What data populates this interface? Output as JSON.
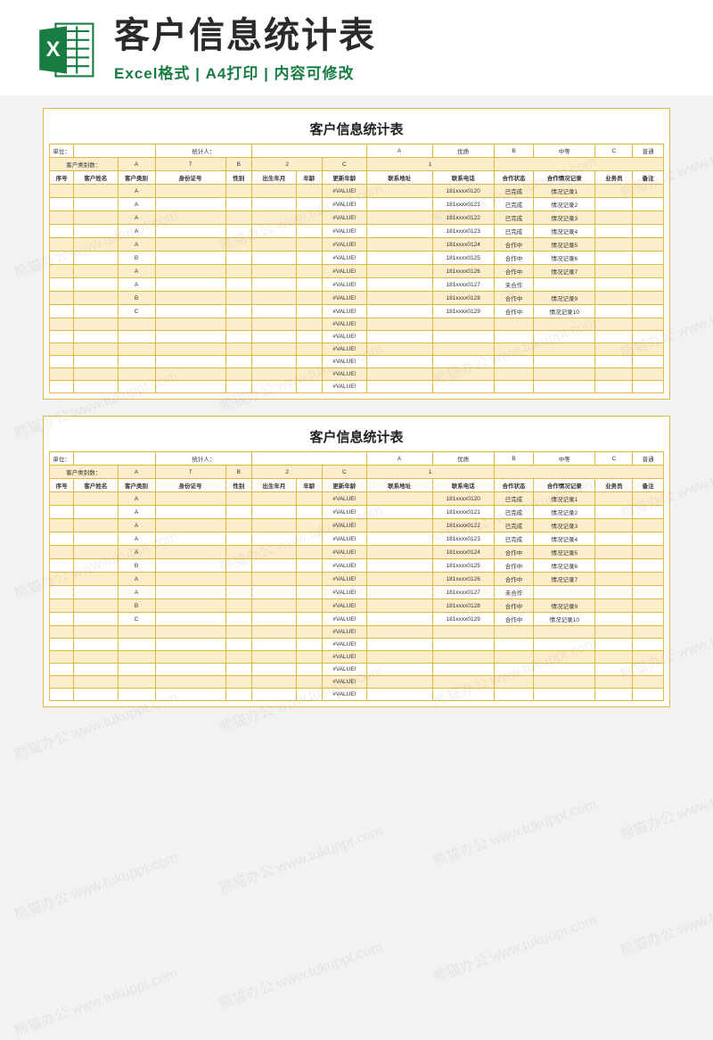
{
  "header": {
    "title": "客户信息统计表",
    "subtitle": "Excel格式 | A4打印 | 内容可修改",
    "icon_letter": "X"
  },
  "sheet": {
    "title": "客户信息统计表",
    "summary1": {
      "unit_label": "单位：",
      "statistician_label": "统计人：",
      "a_label": "A",
      "a_val": "优质",
      "b_label": "B",
      "b_val": "中等",
      "c_label": "C",
      "c_val": "普通"
    },
    "summary2": {
      "label": "客户类别数：",
      "a": "A",
      "a_count": "7",
      "b": "B",
      "b_count": "2",
      "c": "C",
      "c_count": "1"
    },
    "columns": [
      "序号",
      "客户姓名",
      "客户类别",
      "身份证号",
      "性别",
      "出生年月",
      "年龄",
      "更新年龄",
      "联系地址",
      "联系电话",
      "合作状态",
      "合作情况记录",
      "业务员",
      "备注"
    ],
    "rows": [
      {
        "cat": "A",
        "age": "#VALUE!",
        "phone": "181xxxx0120",
        "status": "已完成",
        "rec": "情况记录1"
      },
      {
        "cat": "A",
        "age": "#VALUE!",
        "phone": "181xxxx0121",
        "status": "已完成",
        "rec": "情况记录2"
      },
      {
        "cat": "A",
        "age": "#VALUE!",
        "phone": "181xxxx0122",
        "status": "已完成",
        "rec": "情况记录3"
      },
      {
        "cat": "A",
        "age": "#VALUE!",
        "phone": "181xxxx0123",
        "status": "已完成",
        "rec": "情况记录4"
      },
      {
        "cat": "A",
        "age": "#VALUE!",
        "phone": "181xxxx0124",
        "status": "合作中",
        "rec": "情况记录5"
      },
      {
        "cat": "B",
        "age": "#VALUE!",
        "phone": "181xxxx0125",
        "status": "合作中",
        "rec": "情况记录6"
      },
      {
        "cat": "A",
        "age": "#VALUE!",
        "phone": "181xxxx0126",
        "status": "合作中",
        "rec": "情况记录7"
      },
      {
        "cat": "A",
        "age": "#VALUE!",
        "phone": "181xxxx0127",
        "status": "未合作",
        "rec": ""
      },
      {
        "cat": "B",
        "age": "#VALUE!",
        "phone": "181xxxx0128",
        "status": "合作中",
        "rec": "情况记录9"
      },
      {
        "cat": "C",
        "age": "#VALUE!",
        "phone": "181xxxx0129",
        "status": "合作中",
        "rec": "情况记录10"
      },
      {
        "cat": "",
        "age": "#VALUE!",
        "phone": "",
        "status": "",
        "rec": ""
      },
      {
        "cat": "",
        "age": "#VALUE!",
        "phone": "",
        "status": "",
        "rec": ""
      },
      {
        "cat": "",
        "age": "#VALUE!",
        "phone": "",
        "status": "",
        "rec": ""
      },
      {
        "cat": "",
        "age": "#VALUE!",
        "phone": "",
        "status": "",
        "rec": ""
      },
      {
        "cat": "",
        "age": "#VALUE!",
        "phone": "",
        "status": "",
        "rec": ""
      },
      {
        "cat": "",
        "age": "#VALUE!",
        "phone": "",
        "status": "",
        "rec": ""
      }
    ]
  },
  "watermark": "熊猫办公 www.tukuppt.com"
}
